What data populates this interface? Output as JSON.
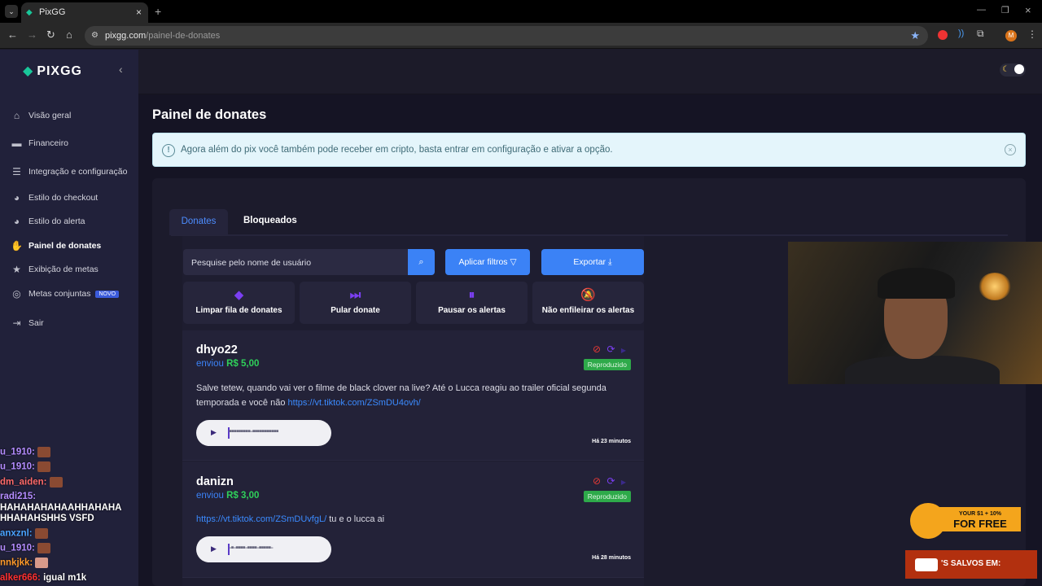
{
  "browser": {
    "tab_title": "PixGG",
    "url_domain": "pixgg.com",
    "url_path": "/painel-de-donates",
    "profile_initial": "M"
  },
  "sidebar": {
    "logo": "PIXGG",
    "items": [
      {
        "label": "Visão geral",
        "icon": "home-icon"
      },
      {
        "label": "Financeiro",
        "icon": "wallet-icon"
      },
      {
        "label": "Integração e configuração",
        "icon": "settings-icon"
      },
      {
        "label": "Estilo do checkout",
        "icon": "palette-icon"
      },
      {
        "label": "Estilo do alerta",
        "icon": "palette-icon"
      },
      {
        "label": "Painel de donates",
        "icon": "hand-coin-icon"
      },
      {
        "label": "Exibição de metas",
        "icon": "star-icon"
      },
      {
        "label": "Metas conjuntas",
        "icon": "target-icon"
      },
      {
        "label": "Sair",
        "icon": "logout-icon"
      }
    ],
    "novo_badge": "NOVO"
  },
  "chat": [
    {
      "user": "u_1910:",
      "msg": "",
      "color": "#b48cff"
    },
    {
      "user": "u_1910:",
      "msg": "",
      "color": "#b48cff"
    },
    {
      "user": "dm_aiden:",
      "msg": "",
      "color": "#ff6a6a"
    },
    {
      "user": "radi215:",
      "msg": "",
      "color": "#b48cff"
    },
    {
      "user": "",
      "msg": "HAHAHAHAHAAHHAHAHA",
      "color": "#ffffff"
    },
    {
      "user": "",
      "msg": "HHAHAHSHHS VSFD",
      "color": "#ffffff"
    },
    {
      "user": "anxznl:",
      "msg": "",
      "color": "#4aa3ff"
    },
    {
      "user": "u_1910:",
      "msg": "",
      "color": "#b48cff"
    },
    {
      "user": "nnkjkk:",
      "msg": "",
      "color": "#ff9a2a"
    },
    {
      "user": "alker666:",
      "msg": "igual m1k",
      "color": "#ff3030"
    }
  ],
  "main": {
    "page_title": "Painel de donates",
    "alert_text": "Agora além do pix você também pode receber em cripto, basta entrar em configuração e ativar a opção.",
    "tabs": [
      "Donates",
      "Bloqueados"
    ],
    "search_placeholder": "Pesquise pelo nome de usuário",
    "filter_button": "Aplicar filtros",
    "export_button": "Exportar",
    "actions": [
      {
        "label": "Limpar fila de donates",
        "icon": "eraser-icon"
      },
      {
        "label": "Pular donate",
        "icon": "skip-icon"
      },
      {
        "label": "Pausar os alertas",
        "icon": "pause-icon"
      },
      {
        "label": "Não enfileirar os alertas",
        "icon": "bell-off-icon"
      }
    ]
  },
  "donates": [
    {
      "name": "dhyo22",
      "sent_label": "enviou",
      "amount": "R$ 5,00",
      "status": "Reproduzido",
      "message": "Salve tetew, quando vai ver o filme de black clover na live? Até o Lucca reagiu ao trailer oficial segunda temporada e você não ",
      "link": "https://vt.tiktok.com/ZSmDU4ovh/",
      "message_after": "",
      "time": "Há 23 minutos"
    },
    {
      "name": "danizn",
      "sent_label": "enviou",
      "amount": "R$ 3,00",
      "status": "Reproduzido",
      "message": "",
      "link": "https://vt.tiktok.com/ZSmDUvfgL/",
      "message_after": " tu e o lucca ai",
      "time": "Há 28 minutos"
    }
  ],
  "overlay": {
    "promo_top": "YOUR $1 + 10%",
    "promo_main": "FOR FREE",
    "saved_text": "'S SALVOS EM:"
  }
}
